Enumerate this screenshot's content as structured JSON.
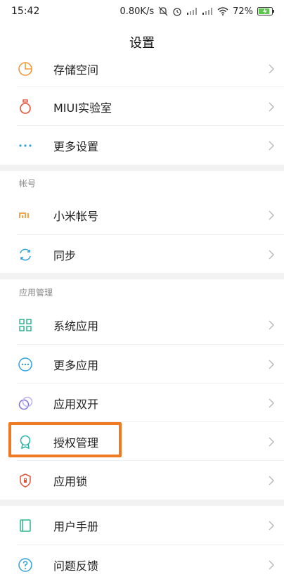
{
  "status_bar": {
    "time": "15:42",
    "network_speed": "0.80K/s",
    "battery": "72%"
  },
  "header": {
    "title": "设置"
  },
  "sections": {
    "account_title": "帐号",
    "apps_title": "应用管理"
  },
  "items": {
    "storage": "存储空间",
    "miui_lab": "MIUI实验室",
    "more_settings": "更多设置",
    "mi_account": "小米帐号",
    "sync": "同步",
    "system_apps": "系统应用",
    "more_apps": "更多应用",
    "dual_apps": "应用双开",
    "permissions": "授权管理",
    "app_lock": "应用锁",
    "user_manual": "用户手册",
    "feedback": "问题反馈"
  },
  "icons": {
    "storage": "pie-chart-icon",
    "miui_lab": "flask-icon",
    "more_settings": "ellipsis-icon",
    "mi_account": "mi-logo-icon",
    "sync": "sync-icon",
    "system_apps": "grid-icon",
    "more_apps": "more-circle-icon",
    "dual_apps": "dual-circle-icon",
    "permissions": "badge-icon",
    "app_lock": "shield-lock-icon",
    "user_manual": "book-icon",
    "feedback": "question-icon"
  },
  "colors": {
    "highlight": "#f07a22",
    "orange": "#f39a3a",
    "blue": "#2fa1dc",
    "green": "#2cb78f",
    "red": "#e0533a",
    "purple": "#7b6fe0",
    "teal": "#25b3a3",
    "charging": "#5cc84c"
  }
}
